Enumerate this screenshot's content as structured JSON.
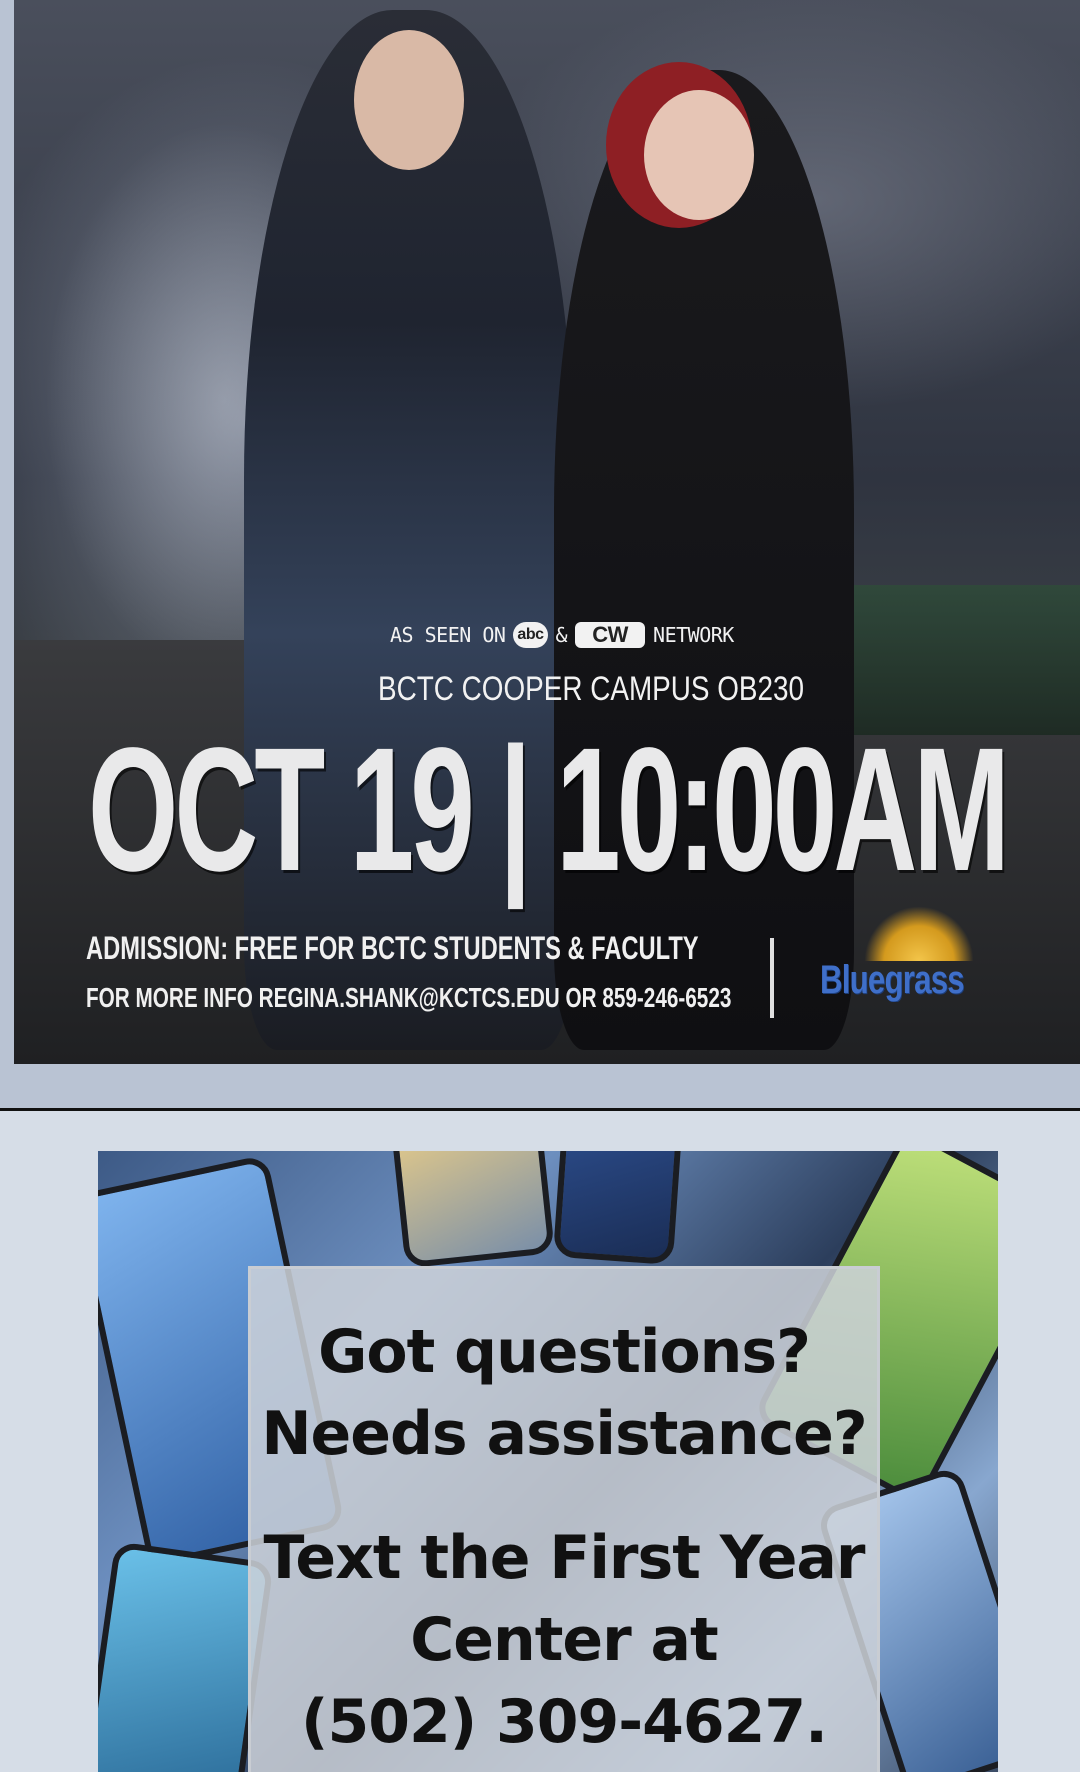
{
  "poster": {
    "seen_on_prefix": "AS SEEN ON",
    "network_1": "abc",
    "amp": "&",
    "network_2": "CW",
    "seen_on_suffix": "NETWORK",
    "campus": "BCTC COOPER CAMPUS OB230",
    "datetime": "OCT 19 | 10:00AM",
    "admission": "ADMISSION: FREE FOR BCTC STUDENTS & FACULTY",
    "more_info": "FOR MORE INFO REGINA.SHANK@KCTCS.EDU OR 859-246-6523",
    "logo_text": "Bluegrass"
  },
  "info_card": {
    "line_1": "Got questions?",
    "line_2": "Needs assistance?",
    "line_3": "Text the First Year",
    "line_4": "Center at",
    "line_5": "(502) 309-4627."
  },
  "colors": {
    "page_background": "#d6dde7",
    "poster_frame": "#b9c3d3",
    "logo_blue": "#3f6fc9",
    "logo_gold": "#f3c54a"
  }
}
